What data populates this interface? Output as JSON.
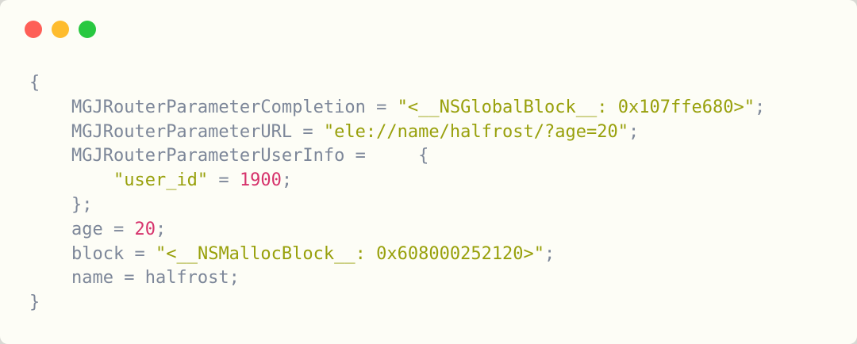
{
  "window": {
    "buttons": [
      {
        "name": "close",
        "color": "#fe5f57"
      },
      {
        "name": "minimize",
        "color": "#febc2e"
      },
      {
        "name": "zoom",
        "color": "#28c840"
      }
    ]
  },
  "colors": {
    "text": "#7d8799",
    "string": "#98a00b",
    "number": "#d6336c"
  },
  "code": {
    "open_brace": "{",
    "completion_key": "MGJRouterParameterCompletion",
    "completion_eq": " = ",
    "completion_value": "\"<__NSGlobalBlock__: 0x107ffe680>\"",
    "completion_end": ";",
    "url_key": "MGJRouterParameterURL",
    "url_eq": " = ",
    "url_value": "\"ele://name/halfrost/?age=20\"",
    "url_end": ";",
    "userinfo_key": "MGJRouterParameterUserInfo",
    "userinfo_eq": " =     ",
    "userinfo_brace": "{",
    "user_id_key": "\"user_id\"",
    "user_id_eq": " = ",
    "user_id_value": "1900",
    "user_id_end": ";",
    "userinfo_close": "};",
    "age_key": "age",
    "age_eq": " = ",
    "age_value": "20",
    "age_end": ";",
    "block_key": "block",
    "block_eq": " = ",
    "block_value": "\"<__NSMallocBlock__: 0x608000252120>\"",
    "block_end": ";",
    "name_line": "name = halfrost;",
    "close_brace": "}"
  }
}
